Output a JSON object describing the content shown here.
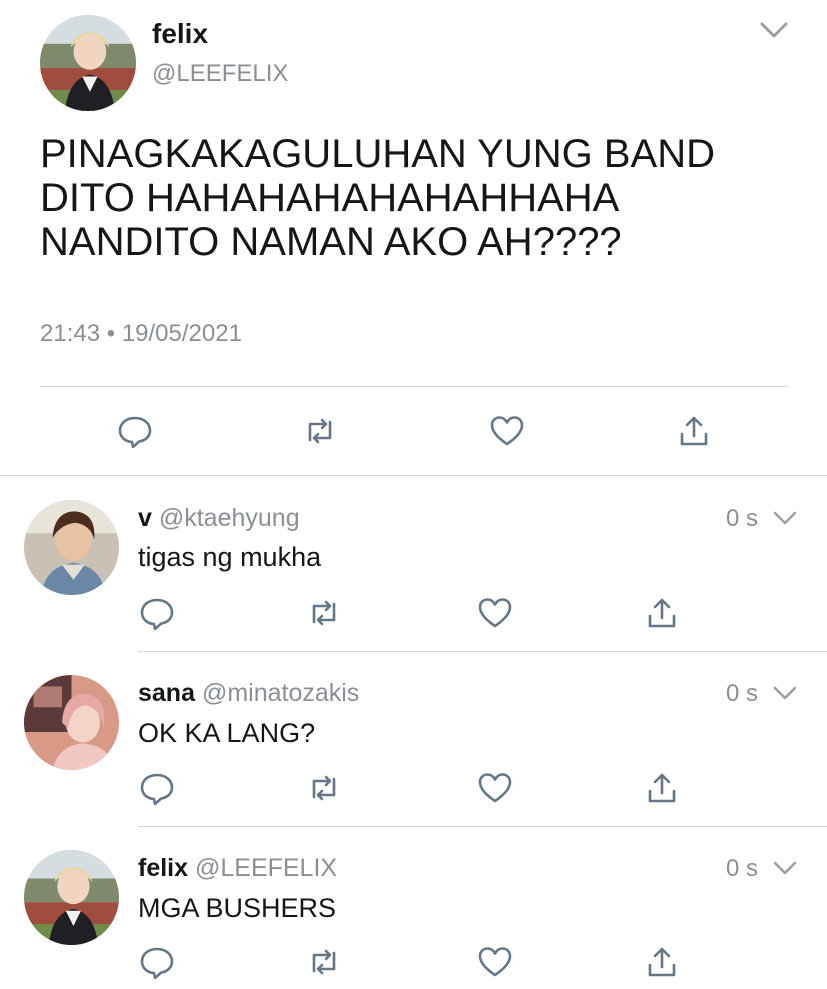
{
  "tweet": {
    "name": "felix",
    "handle": "@LEEFELIX",
    "text": "PINAGKAKAGULUHAN YUNG BAND\nDITO HAHAHAHAHAHAHHAHA\nNANDITO NAMAN AKO AH????",
    "time": "21:43",
    "separator": "•",
    "date": "19/05/2021"
  },
  "actions": [
    "reply-icon",
    "retweet-icon",
    "like-icon",
    "share-icon"
  ],
  "replies": [
    {
      "name": "v",
      "handle": "@ktaehyung",
      "time": "0 s",
      "text": "tigas ng mukha"
    },
    {
      "name": "sana",
      "handle": "@minatozakis",
      "time": "0 s",
      "text": "OK KA LANG?"
    },
    {
      "name": "felix",
      "handle": "@LEEFELIX",
      "time": "0 s",
      "text": "MGA BUSHERS"
    }
  ],
  "colors": {
    "text": "#14171a",
    "muted": "#8a8f95",
    "divider": "#d6d9db",
    "icon": "#657786"
  }
}
